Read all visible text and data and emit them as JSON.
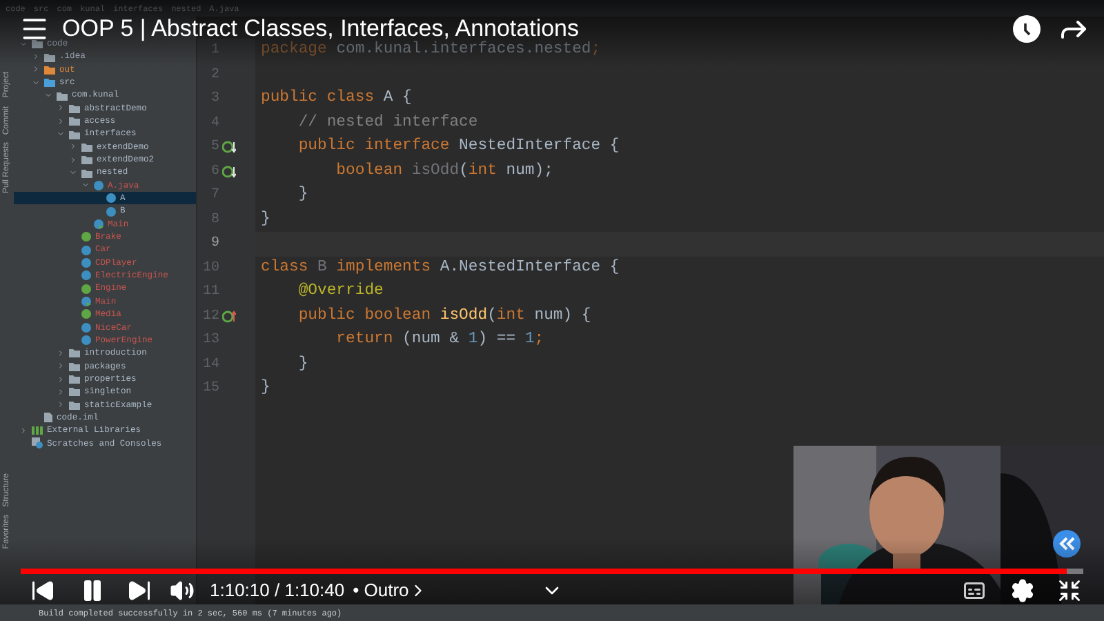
{
  "ide": {
    "breadcrumbs": [
      "code",
      "src",
      "com",
      "kunal",
      "interfaces",
      "nested",
      "A.java"
    ],
    "side_tabs_top": [
      "Project",
      "Commit",
      "Pull Requests"
    ],
    "side_tabs_bottom": [
      "Structure",
      "Favorites"
    ],
    "tree": [
      {
        "name": "code",
        "kind": "folder",
        "expanded": true,
        "selected": false,
        "children": [
          {
            "name": ".idea",
            "kind": "folder",
            "expanded": false,
            "selected": false
          },
          {
            "name": "out",
            "kind": "folder_out",
            "expanded": false,
            "selected": false,
            "color": "#e0883a"
          },
          {
            "name": "src",
            "kind": "folder_src",
            "expanded": true,
            "selected": false,
            "children": [
              {
                "name": "com.kunal",
                "kind": "package",
                "expanded": true,
                "selected": false,
                "children": [
                  {
                    "name": "abstractDemo",
                    "kind": "package",
                    "expanded": false,
                    "selected": false
                  },
                  {
                    "name": "access",
                    "kind": "package",
                    "expanded": false,
                    "selected": false
                  },
                  {
                    "name": "interfaces",
                    "kind": "package",
                    "expanded": true,
                    "selected": false,
                    "children": [
                      {
                        "name": "extendDemo",
                        "kind": "package",
                        "expanded": false,
                        "selected": false
                      },
                      {
                        "name": "extendDemo2",
                        "kind": "package",
                        "expanded": false,
                        "selected": false
                      },
                      {
                        "name": "nested",
                        "kind": "package",
                        "expanded": true,
                        "selected": false,
                        "children": [
                          {
                            "name": "A.java",
                            "kind": "class",
                            "expanded": true,
                            "selected": false,
                            "color": "#c75450",
                            "children": [
                              {
                                "name": "A",
                                "kind": "class",
                                "selected": true
                              },
                              {
                                "name": "B",
                                "kind": "class",
                                "selected": false
                              }
                            ]
                          },
                          {
                            "name": "Main",
                            "kind": "main_class",
                            "selected": false,
                            "color": "#c75450"
                          }
                        ]
                      },
                      {
                        "name": "Brake",
                        "kind": "interface",
                        "selected": false,
                        "color": "#c75450"
                      },
                      {
                        "name": "Car",
                        "kind": "class",
                        "selected": false,
                        "color": "#c75450"
                      },
                      {
                        "name": "CDPlayer",
                        "kind": "class",
                        "selected": false,
                        "color": "#c75450"
                      },
                      {
                        "name": "ElectricEngine",
                        "kind": "class",
                        "selected": false,
                        "color": "#c75450"
                      },
                      {
                        "name": "Engine",
                        "kind": "interface",
                        "selected": false,
                        "color": "#c75450"
                      },
                      {
                        "name": "Main",
                        "kind": "main_class",
                        "selected": false,
                        "color": "#c75450"
                      },
                      {
                        "name": "Media",
                        "kind": "interface",
                        "selected": false,
                        "color": "#c75450"
                      },
                      {
                        "name": "NiceCar",
                        "kind": "class",
                        "selected": false,
                        "color": "#c75450"
                      },
                      {
                        "name": "PowerEngine",
                        "kind": "class",
                        "selected": false,
                        "color": "#c75450"
                      }
                    ]
                  },
                  {
                    "name": "introduction",
                    "kind": "package",
                    "expanded": false,
                    "selected": false
                  },
                  {
                    "name": "packages",
                    "kind": "package",
                    "expanded": false,
                    "selected": false
                  },
                  {
                    "name": "properties",
                    "kind": "package",
                    "expanded": false,
                    "selected": false
                  },
                  {
                    "name": "singleton",
                    "kind": "package",
                    "expanded": false,
                    "selected": false
                  },
                  {
                    "name": "staticExample",
                    "kind": "package",
                    "expanded": false,
                    "selected": false
                  }
                ]
              }
            ]
          },
          {
            "name": "code.iml",
            "kind": "file",
            "selected": false
          }
        ]
      },
      {
        "name": "External Libraries",
        "kind": "library",
        "expanded": false,
        "selected": false
      },
      {
        "name": "Scratches and Consoles",
        "kind": "scratches",
        "selected": false
      }
    ],
    "code_lines": [
      {
        "number": "1",
        "current": false,
        "tokens": [
          {
            "text": "package ",
            "kind": "keyword_dim"
          },
          {
            "text": "com.kunal.interfaces.nested",
            "kind": "plain_dim"
          },
          {
            "text": ";",
            "kind": "keyword_dim"
          }
        ]
      },
      {
        "number": "2",
        "current": false
      },
      {
        "number": "3",
        "current": false,
        "tokens": [
          {
            "text": "public class ",
            "kind": "keyword"
          },
          {
            "text": "A {",
            "kind": "plain"
          }
        ]
      },
      {
        "number": "4",
        "current": false,
        "tokens": [
          {
            "text": "    // nested interface",
            "kind": "comment"
          }
        ]
      },
      {
        "number": "5",
        "current": false,
        "marker": {
          "kind": "implemented"
        },
        "tokens": [
          {
            "text": "    public interface ",
            "kind": "keyword"
          },
          {
            "text": "NestedInterface {",
            "kind": "plain"
          }
        ]
      },
      {
        "number": "6",
        "current": false,
        "marker": {
          "kind": "implemented"
        },
        "tokens": [
          {
            "text": "        boolean ",
            "kind": "keyword"
          },
          {
            "text": "isOdd",
            "kind": "unused"
          },
          {
            "text": "(",
            "kind": "plain"
          },
          {
            "text": "int ",
            "kind": "keyword"
          },
          {
            "text": "num);",
            "kind": "plain"
          }
        ]
      },
      {
        "number": "7",
        "current": false,
        "tokens": [
          {
            "text": "    }",
            "kind": "plain"
          }
        ]
      },
      {
        "number": "8",
        "current": false,
        "tokens": [
          {
            "text": "}",
            "kind": "plain"
          }
        ]
      },
      {
        "number": "9",
        "current": true
      },
      {
        "number": "10",
        "current": false,
        "tokens": [
          {
            "text": "class ",
            "kind": "keyword"
          },
          {
            "text": "B ",
            "kind": "unused"
          },
          {
            "text": "implements ",
            "kind": "keyword"
          },
          {
            "text": "A.NestedInterface {",
            "kind": "plain"
          }
        ]
      },
      {
        "number": "11",
        "current": false,
        "tokens": [
          {
            "text": "    @Override",
            "kind": "annotation"
          }
        ]
      },
      {
        "number": "12",
        "current": false,
        "marker": {
          "kind": "implementing"
        },
        "tokens": [
          {
            "text": "    public boolean ",
            "kind": "keyword"
          },
          {
            "text": "isOdd",
            "kind": "method"
          },
          {
            "text": "(",
            "kind": "plain"
          },
          {
            "text": "int ",
            "kind": "keyword"
          },
          {
            "text": "num) {",
            "kind": "plain"
          }
        ]
      },
      {
        "number": "13",
        "current": false,
        "tokens": [
          {
            "text": "        return ",
            "kind": "keyword"
          },
          {
            "text": "(num & ",
            "kind": "plain"
          },
          {
            "text": "1",
            "kind": "number"
          },
          {
            "text": ") == ",
            "kind": "plain"
          },
          {
            "text": "1",
            "kind": "number"
          },
          {
            "text": ";",
            "kind": "keyword"
          }
        ]
      },
      {
        "number": "14",
        "current": false,
        "tokens": [
          {
            "text": "    }",
            "kind": "plain"
          }
        ]
      },
      {
        "number": "15",
        "current": false,
        "tokens": [
          {
            "text": "}",
            "kind": "plain"
          }
        ]
      }
    ],
    "status": "Build completed successfully in 2 sec, 560 ms (7 minutes ago)"
  },
  "player": {
    "title": "OOP 5 | Abstract Classes, Interfaces, Annotations",
    "progress": {
      "level": 0.985
    },
    "playing": true,
    "time": "1:10:10 / 1:10:40",
    "chapter": "• Outro"
  }
}
